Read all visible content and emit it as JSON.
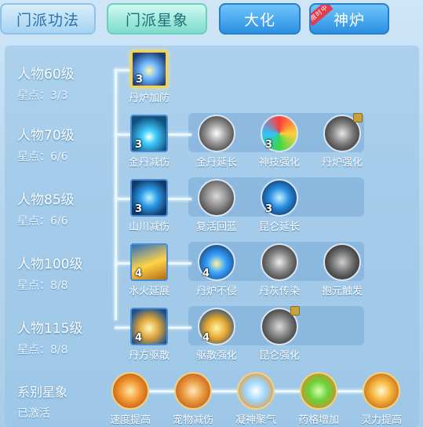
{
  "tabs": [
    {
      "label": "门派功法"
    },
    {
      "label": "门派星象"
    },
    {
      "label": "大化"
    },
    {
      "label": "神炉",
      "ribbon": "限时中"
    }
  ],
  "rows": [
    {
      "level": "人物60级",
      "points": "星点：3/3",
      "skills": [
        {
          "name": "丹炉加防",
          "lv": "3",
          "icon": "furnace-defense-icon"
        }
      ]
    },
    {
      "level": "人物70级",
      "points": "星点：6/6",
      "skills": [
        {
          "name": "金丹减伤",
          "lv": "3",
          "icon": "golden-pill-icon"
        },
        {
          "name": "金丹延长",
          "lv": "",
          "icon": "extend-icon"
        },
        {
          "name": "神技强化",
          "lv": "3",
          "icon": "divine-skill-icon"
        },
        {
          "name": "丹炉强化",
          "lv": "",
          "icon": "furnace-upgrade-icon",
          "locked": true
        }
      ]
    },
    {
      "level": "人物85级",
      "points": "星点：6/6",
      "skills": [
        {
          "name": "山川减伤",
          "lv": "3",
          "icon": "mountain-icon"
        },
        {
          "name": "复活回蓝",
          "lv": "",
          "icon": "revive-icon"
        },
        {
          "name": "昆仑延长",
          "lv": "3",
          "icon": "kunlun-icon"
        }
      ]
    },
    {
      "level": "人物100级",
      "points": "星点：8/8",
      "skills": [
        {
          "name": "水火延展",
          "lv": "4",
          "icon": "water-fire-icon"
        },
        {
          "name": "丹炉不侵",
          "lv": "4",
          "icon": "furnace-shield-icon"
        },
        {
          "name": "丹灰传染",
          "lv": "",
          "icon": "ash-icon"
        },
        {
          "name": "抱元触发",
          "lv": "",
          "icon": "meditate-icon"
        }
      ]
    },
    {
      "level": "人物115级",
      "points": "星点：8/8",
      "skills": [
        {
          "name": "丹方驱散",
          "lv": "4",
          "icon": "dispel-icon"
        },
        {
          "name": "驱散强化",
          "lv": "4",
          "icon": "dispel-upgrade-icon"
        },
        {
          "name": "昆仑强化",
          "lv": "",
          "icon": "kunlun-upgrade-icon",
          "locked": true
        }
      ]
    }
  ],
  "series": {
    "title": "系别星象",
    "status": "已激活",
    "skills": [
      {
        "name": "速度提高",
        "icon": "speed-icon"
      },
      {
        "name": "宠物减伤",
        "icon": "pet-icon"
      },
      {
        "name": "凝神聚气",
        "icon": "focus-icon"
      },
      {
        "name": "药格增加",
        "icon": "gem-icon"
      },
      {
        "name": "灵力提高",
        "icon": "spirit-icon"
      }
    ]
  },
  "colors": {
    "accent": "#2b8fe2",
    "gold": "#f7d34c"
  }
}
